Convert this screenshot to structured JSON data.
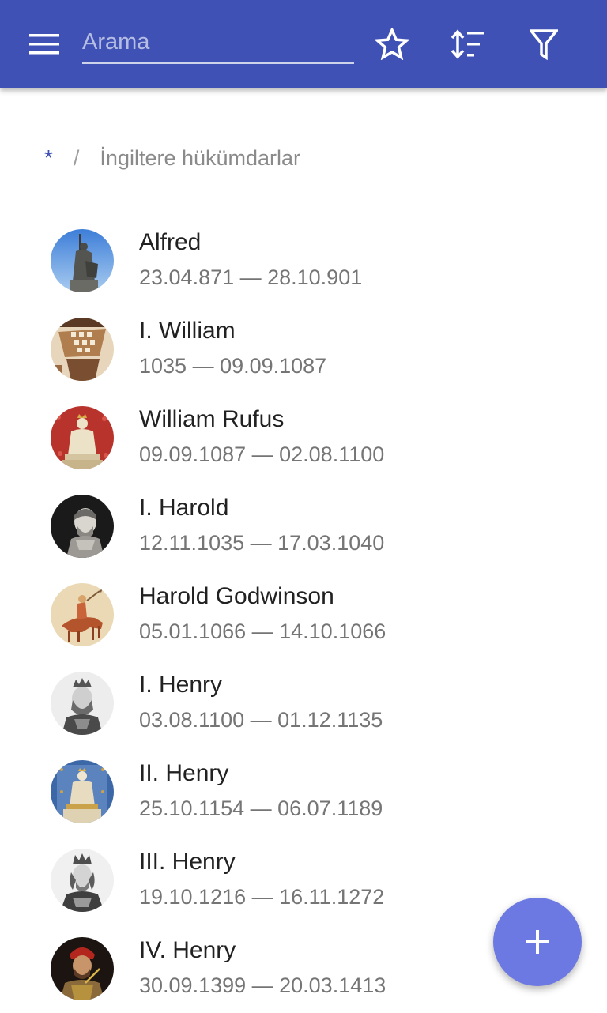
{
  "app_bar": {
    "color": "#3f51b5",
    "menu_icon": "hamburger-menu-icon",
    "search": {
      "placeholder": "Arama",
      "value": ""
    },
    "actions": [
      "star-outline-icon",
      "sort-icon",
      "filter-icon"
    ]
  },
  "breadcrumb": {
    "root": "*",
    "separator": "/",
    "current": "İngiltere hükümdarlar"
  },
  "rulers": [
    {
      "name": "Alfred",
      "dates": "23.04.871 — 28.10.901",
      "avatar": "statue-portrait"
    },
    {
      "name": "I. William",
      "dates": "1035 — 09.09.1087",
      "avatar": "tapestry-portrait"
    },
    {
      "name": "William Rufus",
      "dates": "09.09.1087 — 02.08.1100",
      "avatar": "enthroned-king-red"
    },
    {
      "name": "I. Harold",
      "dates": "12.11.1035 — 17.03.1040",
      "avatar": "engraving-portrait"
    },
    {
      "name": "Harold Godwinson",
      "dates": "05.01.1066 — 14.10.1066",
      "avatar": "horseman-tapestry"
    },
    {
      "name": "I. Henry",
      "dates": "03.08.1100 — 01.12.1135",
      "avatar": "crowned-engraving"
    },
    {
      "name": "II. Henry",
      "dates": "25.10.1154 — 06.07.1189",
      "avatar": "enthroned-king-blue"
    },
    {
      "name": "III. Henry",
      "dates": "19.10.1216 — 16.11.1272",
      "avatar": "crowned-engraving"
    },
    {
      "name": "IV. Henry",
      "dates": "30.09.1399 — 20.03.1413",
      "avatar": "painted-portrait"
    }
  ],
  "fab": {
    "icon": "plus-icon",
    "color": "#6d79e3"
  }
}
